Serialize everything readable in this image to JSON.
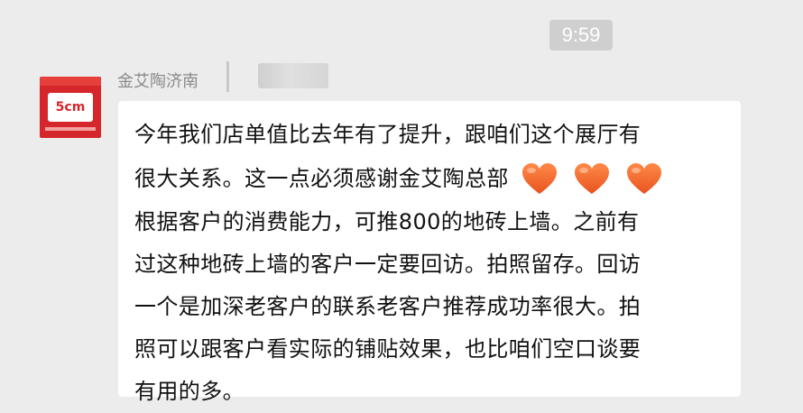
{
  "status_bar": {
    "time": "9:59"
  },
  "sender": {
    "name": "金艾陶济南",
    "avatar_text": "5cm"
  },
  "message": {
    "lines": [
      "今年我们店单值比去年有了提升，跟咱们这个展厅有",
      "很大关系。这一点必须感谢金艾陶总部",
      "根据客户的消费能力，可推800的地砖上墙。之前有",
      "过这种地砖上墙的客户一定要回访。拍照留存。回访",
      "一个是加深老客户的联系老客户推荐成功率很大。拍",
      "照可以跟客户看实际的铺贴效果，也比咱们空口谈要",
      "有用的多。"
    ],
    "emoji": [
      "heart-icon",
      "heart-icon",
      "heart-icon"
    ]
  },
  "colors": {
    "background": "#ececec",
    "bubble": "#ffffff",
    "heart": "#f06a2f",
    "avatar": "#d4262b"
  }
}
